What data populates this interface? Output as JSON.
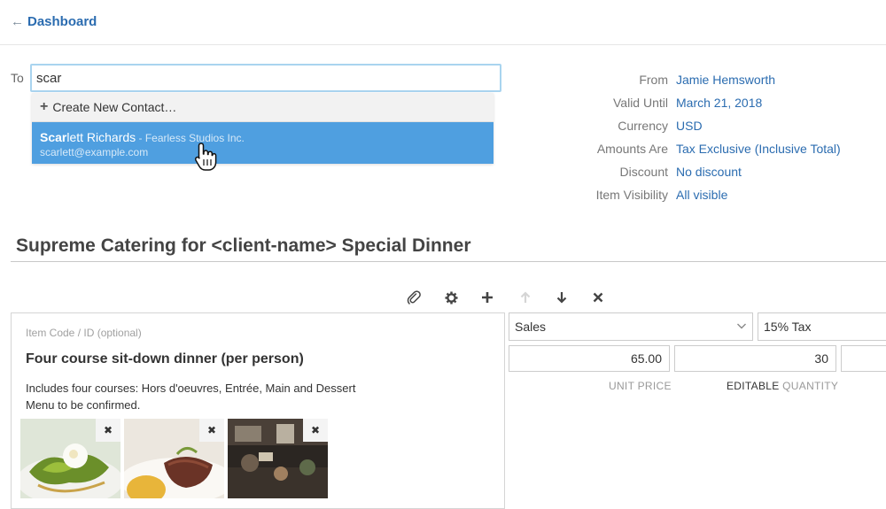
{
  "header": {
    "back_arrow": "←",
    "back_label": "Dashboard"
  },
  "recipient": {
    "label": "To",
    "value": "scar",
    "dropdown": {
      "create_label": "Create New Contact…",
      "match": {
        "name_match": "Scar",
        "name_rest": "lett Richards",
        "company": " - Fearless Studios Inc.",
        "email": "scarlett@example.com"
      }
    }
  },
  "properties": [
    {
      "label": "From",
      "value": "Jamie Hemsworth"
    },
    {
      "label": "Valid Until",
      "value": "March 21, 2018"
    },
    {
      "label": "Currency",
      "value": "USD"
    },
    {
      "label": "Amounts Are",
      "value": "Tax Exclusive (Inclusive Total)"
    },
    {
      "label": "Discount",
      "value": "No discount"
    },
    {
      "label": "Item Visibility",
      "value": "All visible"
    }
  ],
  "document": {
    "title": "Supreme Catering for <client-name> Special Dinner"
  },
  "toolbar_icons": [
    "paperclip-icon",
    "gear-icon",
    "plus-icon",
    "arrow-up-icon",
    "arrow-down-icon",
    "close-icon"
  ],
  "item": {
    "code_placeholder": "Item Code / ID (optional)",
    "name": "Four course sit-down dinner (per person)",
    "description": "Includes four courses: Hors d'oeuvres, Entrée, Main and Dessert\nMenu to be confirmed.",
    "remove_glyph": "✖",
    "account": "Sales",
    "tax": "15% Tax",
    "unit_price": "65.00",
    "quantity": "30",
    "unit_price_label": "UNIT PRICE",
    "quantity_label_prefix": "EDITABLE",
    "quantity_label": " QUANTITY"
  },
  "colors": {
    "link": "#2b6cb0",
    "highlight": "#4f9fe0",
    "input_focus": "#a9d4ef"
  }
}
